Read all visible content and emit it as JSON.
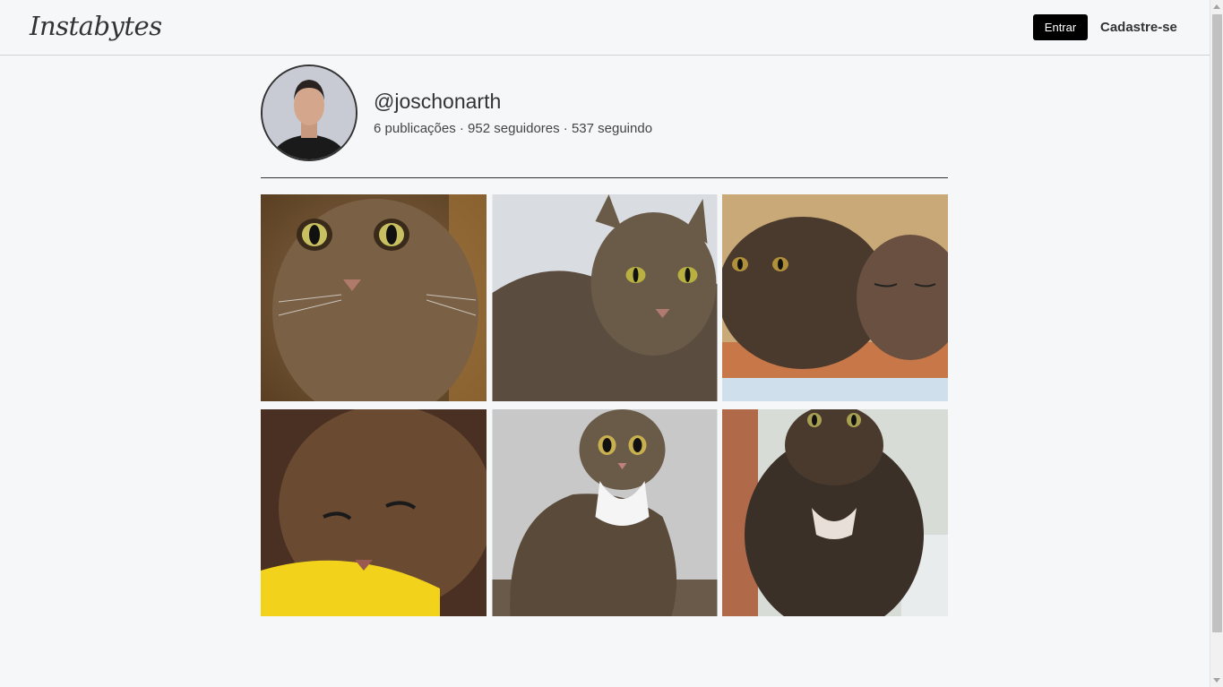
{
  "header": {
    "logo": "Instabytes",
    "login_label": "Entrar",
    "signup_label": "Cadastre-se"
  },
  "profile": {
    "username": "@joschonarth",
    "stats": "6 publicações · 952 seguidores · 537 seguindo"
  },
  "posts": [
    {
      "subject": "tabby cat close-up"
    },
    {
      "subject": "tabby cat lying down"
    },
    {
      "subject": "two tabby cats resting"
    },
    {
      "subject": "tabby kitten on yellow pillow"
    },
    {
      "subject": "tabby and white cat sitting"
    },
    {
      "subject": "long-haired tortoiseshell cat"
    }
  ]
}
